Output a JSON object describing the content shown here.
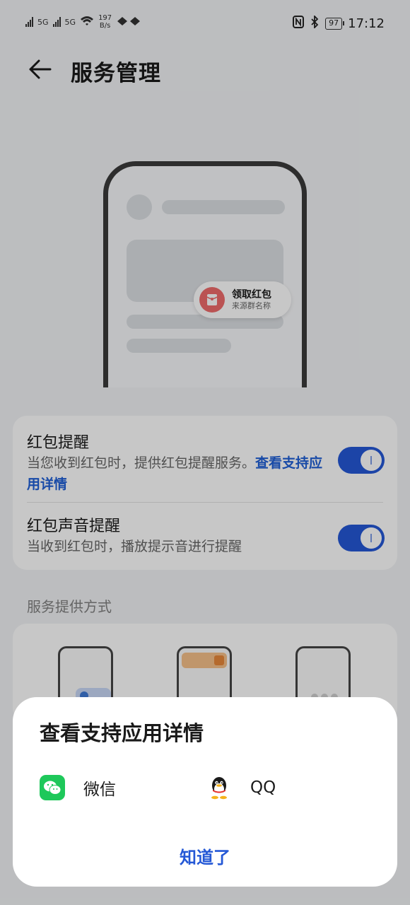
{
  "status_bar": {
    "network_left": "5G",
    "network_right": "5G",
    "speed_value": "197",
    "speed_unit": "B/s",
    "battery": "97",
    "time": "17:12"
  },
  "header": {
    "back_icon": "back-arrow-icon",
    "title": "服务管理"
  },
  "illustration": {
    "pill_title": "领取红包",
    "pill_subtitle": "来源群名称",
    "accent_color": "#ef6b6b"
  },
  "settings": {
    "red_packet_reminder": {
      "title": "红包提醒",
      "desc_prefix": "当您收到红包时，提供红包提醒服务。",
      "desc_link": "查看支持应用详情",
      "enabled": true
    },
    "red_packet_sound": {
      "title": "红包声音提醒",
      "desc": "当收到红包时，播放提示音进行提醒",
      "enabled": true
    },
    "toggle_color": "#2458d6"
  },
  "service_section": {
    "label": "服务提供方式"
  },
  "dialog": {
    "title": "查看支持应用详情",
    "apps": [
      {
        "name": "微信",
        "icon": "wechat-icon",
        "color": "#1ec85a"
      },
      {
        "name": "QQ",
        "icon": "qq-penguin-icon"
      }
    ],
    "ok_label": "知道了",
    "link_color": "#2458d6"
  }
}
